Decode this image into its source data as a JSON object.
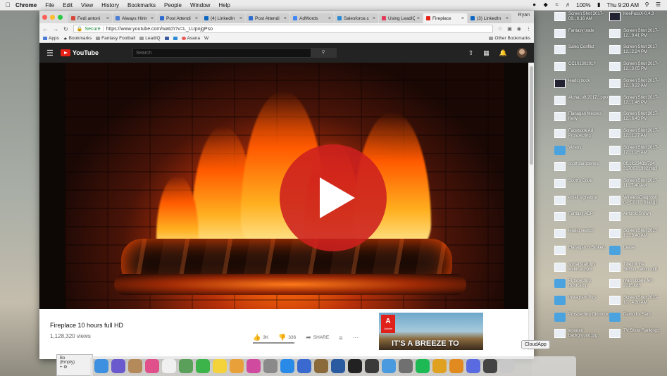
{
  "menubar": {
    "app": "Chrome",
    "items": [
      "File",
      "Edit",
      "View",
      "History",
      "Bookmarks",
      "People",
      "Window",
      "Help"
    ],
    "battery": "100%",
    "clock": "Thu 9:20 AM"
  },
  "browser": {
    "tabs": [
      {
        "label": "Fedi antoni",
        "color": "#d44638"
      },
      {
        "label": "Always Hirin",
        "color": "#4a7bd6"
      },
      {
        "label": "Post Attendi",
        "color": "#2d6bcf"
      },
      {
        "label": "(4) LinkedIn",
        "color": "#0a66c2"
      },
      {
        "label": "Post Attendi",
        "color": "#2d6bcf"
      },
      {
        "label": "AdWords",
        "color": "#4285f4"
      },
      {
        "label": "Salesforce.c",
        "color": "#2a8ad4"
      },
      {
        "label": "Using LeadIQ",
        "color": "#e23a5a"
      },
      {
        "label": "Fireplace",
        "color": "#e62117"
      },
      {
        "label": "(3) LinkedIn",
        "color": "#0a66c2"
      }
    ],
    "active_tab_index": 8,
    "profile": "Ryan",
    "secure_label": "Secure",
    "url": "https://www.youtube.com/watch?v=L_LUpnjgPso",
    "bookmarks": [
      "Apps",
      "Bookmarks",
      "Fantasy Football",
      "LeadIQ",
      "Asana",
      "W"
    ],
    "other_bookmarks": "Other Bookmarks"
  },
  "youtube": {
    "logo": "YouTube",
    "search_placeholder": "Search",
    "video_title": "Fireplace 10 hours full HD",
    "views": "1,128,320 views",
    "likes": "3K",
    "dislikes": "336",
    "share": "SHARE",
    "ad_brand": "Adobe",
    "ad_text": "IT'S A BREEZE TO"
  },
  "desktop_files": [
    {
      "label": "Screen Shot 2017-09...8.16 AM",
      "kind": "shot"
    },
    {
      "label": "KeePassX-0.4.3",
      "kind": "dark"
    },
    {
      "label": "Fantasy trade",
      "kind": "doc"
    },
    {
      "label": "Screen Shot 2017-12...9.41 PM",
      "kind": "shot"
    },
    {
      "label": "Sales Conflict",
      "kind": "doc"
    },
    {
      "label": "Screen Shot 2017-12...2.24 PM",
      "kind": "shot"
    },
    {
      "label": "CC10130201?",
      "kind": "doc"
    },
    {
      "label": "Screen Shot 2017-12...3.05 PM",
      "kind": "shot"
    },
    {
      "label": "leadiq dock",
      "kind": "dark"
    },
    {
      "label": "Screen Shot 2017-12...8.22 AM",
      "kind": "shot"
    },
    {
      "label": "AlphaLoft 2017...pptx",
      "kind": "doc"
    },
    {
      "label": "Screen Shot 2017-12...1.46 PM",
      "kind": "shot"
    },
    {
      "label": "Flanagan Messes Kelly",
      "kind": "doc"
    },
    {
      "label": "Screen Shot 2017-12...6.43 PM",
      "kind": "shot"
    },
    {
      "label": "Facebook Ad Prospecting",
      "kind": "doc"
    },
    {
      "label": "Screen Shot 2017-12...1.27 AM",
      "kind": "shot"
    },
    {
      "label": "Videos",
      "kind": "folder"
    },
    {
      "label": "Screen Shot 2017-12...1.26 AM",
      "kind": "shot"
    },
    {
      "label": "scott barobenes",
      "kind": "doc"
    },
    {
      "label": "8f1cfc2343bf724 317067...992.mp3",
      "kind": "doc"
    },
    {
      "label": "Scott's Code",
      "kind": "doc"
    },
    {
      "label": "Screen Shot 2017-11...7.40 AM",
      "kind": "shot"
    },
    {
      "label": "email signature",
      "kind": "doc"
    },
    {
      "label": "WirelessDiagnosti cs_C02L...8.tar.gz",
      "kind": "doc"
    },
    {
      "label": "Fantasy ADP",
      "kind": "doc"
    },
    {
      "label": "Antonio Brown",
      "kind": "doc"
    },
    {
      "label": "leadiq search",
      "kind": "doc"
    },
    {
      "label": "Screen Shot 2017-10...8.48 AM",
      "kind": "shot"
    },
    {
      "label": "Flanagan is Stoked",
      "kind": "doc"
    },
    {
      "label": "Lease",
      "kind": "folder"
    },
    {
      "label": "social startups webinar.pptx",
      "kind": "doc"
    },
    {
      "label": "Title for the Subscr...ation .pdf",
      "kind": "doc"
    },
    {
      "label": "Prospecting Bootcamp",
      "kind": "folder"
    },
    {
      "label": "ryan update feb 2016.kdb",
      "kind": "doc"
    },
    {
      "label": "Instagram Pics",
      "kind": "folder"
    },
    {
      "label": "Screen Shot 2017-10...4.30 AM",
      "kind": "shot"
    },
    {
      "label": "Prospecting Gimmicks",
      "kind": "folder"
    },
    {
      "label": "Demo for Sam",
      "kind": "folder"
    },
    {
      "label": "wooden background.jpg",
      "kind": "doc"
    },
    {
      "label": "TV Show Rankings",
      "kind": "doc"
    }
  ],
  "mini_panel": {
    "title": "Bo",
    "status": "(Empty)"
  },
  "dock": {
    "tooltip": "CloudApp",
    "apps": [
      {
        "name": "finder-icon",
        "color": "#3d8fe0"
      },
      {
        "name": "siri-icon",
        "color": "#6a5acd"
      },
      {
        "name": "notes-icon",
        "color": "#b48a5a"
      },
      {
        "name": "itunes-icon",
        "color": "#e0508a"
      },
      {
        "name": "calendar-icon",
        "color": "#f0f0f0"
      },
      {
        "name": "keepassx-icon",
        "color": "#5aa05a"
      },
      {
        "name": "facetime-icon",
        "color": "#3cb44a"
      },
      {
        "name": "stickies-icon",
        "color": "#f3d23a"
      },
      {
        "name": "photos-icon",
        "color": "#e8a03a"
      },
      {
        "name": "music-icon",
        "color": "#d04aa0"
      },
      {
        "name": "launchpad-icon",
        "color": "#8a8a8a"
      },
      {
        "name": "appstore-icon",
        "color": "#2a8ae8"
      },
      {
        "name": "keynote-icon",
        "color": "#3a6ad0"
      },
      {
        "name": "books-icon",
        "color": "#8a6a3a"
      },
      {
        "name": "quicktime-icon",
        "color": "#2a5aa0"
      },
      {
        "name": "terminal-icon",
        "color": "#222222"
      },
      {
        "name": "scrivener-icon",
        "color": "#3a3a3a"
      },
      {
        "name": "chat-icon",
        "color": "#4a9ae0"
      },
      {
        "name": "prefs-icon",
        "color": "#707070"
      },
      {
        "name": "spotify-icon",
        "color": "#1db954"
      },
      {
        "name": "chrome-icon",
        "color": "#e0a020"
      },
      {
        "name": "tool-icon",
        "color": "#e08a20"
      },
      {
        "name": "discord-icon",
        "color": "#5a6ae0"
      },
      {
        "name": "cloudapp-icon",
        "color": "#444444"
      },
      {
        "name": "trash-icon",
        "color": "#c8c8c8"
      }
    ]
  }
}
